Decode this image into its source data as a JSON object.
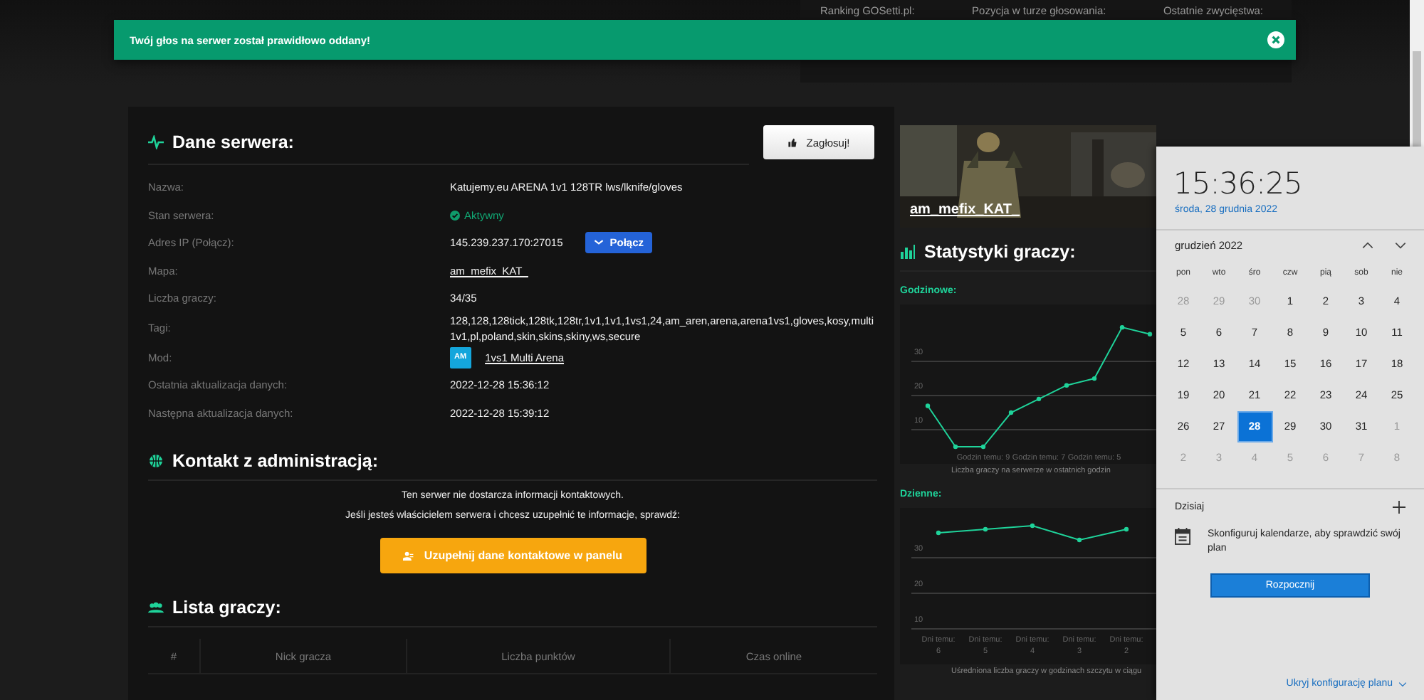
{
  "toast": {
    "message": "Twój głos na serwer został prawidłowo oddany!"
  },
  "header_stats": [
    "Ranking GOSetti.pl:",
    "Pozycja w turze głosowania:",
    "Ostatnie zwycięstwa:"
  ],
  "server": {
    "title": "Dane serwera:",
    "vote_button": "Zagłosuj!",
    "fields": [
      {
        "label": "Nazwa:",
        "kind": "text",
        "value": "Katujemy.eu ARENA 1v1 128TR lws/lknife/gloves"
      },
      {
        "label": "Stan serwera:",
        "kind": "status",
        "value": "Aktywny"
      },
      {
        "label": "Adres IP (Połącz):",
        "kind": "ip",
        "value": "145.239.237.170:27015",
        "button": "Połącz"
      },
      {
        "label": "Mapa:",
        "kind": "link",
        "value": "am_mefix_KAT_"
      },
      {
        "label": "Liczba graczy:",
        "kind": "text",
        "value": "34/35"
      },
      {
        "label": "Tagi:",
        "kind": "text",
        "value": "128,128,128tick,128tk,128tr,1v1,1v1,1vs1,24,am_aren,arena,arena1vs1,gloves,kosy,multi 1v1,pl,poland,skin,skins,skiny,ws,secure"
      },
      {
        "label": "Mod:",
        "kind": "mod",
        "badge": "AM",
        "value": "1vs1 Multi Arena"
      },
      {
        "label": "Ostatnia aktualizacja danych:",
        "kind": "text",
        "value": "2022-12-28 15:36:12"
      },
      {
        "label": "Następna aktualizacja danych:",
        "kind": "text",
        "value": "2022-12-28 15:39:12"
      }
    ]
  },
  "contact": {
    "title": "Kontakt z administracją:",
    "lines": [
      "Ten serwer nie dostarcza informacji kontaktowych.",
      "Jeśli jesteś właścicielem serwera i chcesz uzupełnić te informacje, sprawdź:"
    ],
    "button": "Uzupełnij dane kontaktowe w panelu"
  },
  "players": {
    "title": "Lista graczy:",
    "columns": [
      "#",
      "Nick gracza",
      "Liczba punktów",
      "Czas online"
    ]
  },
  "map_card": {
    "name": "am_mefix_KAT_"
  },
  "stats": {
    "title": "Statystyki graczy:",
    "hourly": {
      "label": "Godzinowe:",
      "caption": "Liczba graczy na serwerze w ostatnich godzin",
      "chart_data": {
        "type": "line",
        "x": [
          11,
          10,
          9,
          8,
          7,
          6,
          5,
          4,
          3
        ],
        "xlim": [
          12,
          2.77
        ],
        "xticks": [
          {
            "value": 9,
            "label": "Godzin temu: 9"
          },
          {
            "value": 7,
            "label": "Godzin temu: 7"
          },
          {
            "value": 5,
            "label": "Godzin temu: 5"
          }
        ],
        "ylim": [
          0,
          46.7
        ],
        "yticks": [
          10,
          20,
          30
        ],
        "grid": true,
        "series": [
          {
            "color": "#1fd39a",
            "marker": "circle",
            "values": [
              17,
              5,
              5,
              15,
              19,
              23,
              25,
              40,
              38
            ]
          }
        ]
      }
    },
    "daily": {
      "label": "Dzienne:",
      "caption": "Uśredniona liczba graczy w godzinach szczytu w ciągu",
      "chart_data": {
        "type": "line",
        "categories": [
          "Dni temu: 6",
          "Dni temu: 5",
          "Dni temu: 4",
          "Dni temu: 3",
          "Dni temu: 2"
        ],
        "ylim": [
          0,
          44
        ],
        "yticks": [
          10,
          20,
          30
        ],
        "grid": true,
        "series": [
          {
            "color": "#1fd39a",
            "marker": "circle",
            "values": [
              37,
              38,
              39,
              35,
              38
            ]
          }
        ]
      }
    }
  },
  "calendar": {
    "time": "15:36:25",
    "date": "środa, 28 grudnia 2022",
    "month": "grudzień 2022",
    "weekdays": [
      "pon",
      "wto",
      "śro",
      "czw",
      "pią",
      "sob",
      "nie"
    ],
    "days": [
      {
        "day": "28",
        "in_month": false,
        "selected": false
      },
      {
        "day": "29",
        "in_month": false,
        "selected": false
      },
      {
        "day": "30",
        "in_month": false,
        "selected": false
      },
      {
        "day": "1",
        "in_month": true,
        "selected": false
      },
      {
        "day": "2",
        "in_month": true,
        "selected": false
      },
      {
        "day": "3",
        "in_month": true,
        "selected": false
      },
      {
        "day": "4",
        "in_month": true,
        "selected": false
      },
      {
        "day": "5",
        "in_month": true,
        "selected": false
      },
      {
        "day": "6",
        "in_month": true,
        "selected": false
      },
      {
        "day": "7",
        "in_month": true,
        "selected": false
      },
      {
        "day": "8",
        "in_month": true,
        "selected": false
      },
      {
        "day": "9",
        "in_month": true,
        "selected": false
      },
      {
        "day": "10",
        "in_month": true,
        "selected": false
      },
      {
        "day": "11",
        "in_month": true,
        "selected": false
      },
      {
        "day": "12",
        "in_month": true,
        "selected": false
      },
      {
        "day": "13",
        "in_month": true,
        "selected": false
      },
      {
        "day": "14",
        "in_month": true,
        "selected": false
      },
      {
        "day": "15",
        "in_month": true,
        "selected": false
      },
      {
        "day": "16",
        "in_month": true,
        "selected": false
      },
      {
        "day": "17",
        "in_month": true,
        "selected": false
      },
      {
        "day": "18",
        "in_month": true,
        "selected": false
      },
      {
        "day": "19",
        "in_month": true,
        "selected": false
      },
      {
        "day": "20",
        "in_month": true,
        "selected": false
      },
      {
        "day": "21",
        "in_month": true,
        "selected": false
      },
      {
        "day": "22",
        "in_month": true,
        "selected": false
      },
      {
        "day": "23",
        "in_month": true,
        "selected": false
      },
      {
        "day": "24",
        "in_month": true,
        "selected": false
      },
      {
        "day": "25",
        "in_month": true,
        "selected": false
      },
      {
        "day": "26",
        "in_month": true,
        "selected": false
      },
      {
        "day": "27",
        "in_month": true,
        "selected": false
      },
      {
        "day": "28",
        "in_month": true,
        "selected": true
      },
      {
        "day": "29",
        "in_month": true,
        "selected": false
      },
      {
        "day": "30",
        "in_month": true,
        "selected": false
      },
      {
        "day": "31",
        "in_month": true,
        "selected": false
      },
      {
        "day": "1",
        "in_month": false,
        "selected": false
      },
      {
        "day": "2",
        "in_month": false,
        "selected": false
      },
      {
        "day": "3",
        "in_month": false,
        "selected": false
      },
      {
        "day": "4",
        "in_month": false,
        "selected": false
      },
      {
        "day": "5",
        "in_month": false,
        "selected": false
      },
      {
        "day": "6",
        "in_month": false,
        "selected": false
      },
      {
        "day": "7",
        "in_month": false,
        "selected": false
      },
      {
        "day": "8",
        "in_month": false,
        "selected": false
      }
    ],
    "today_label": "Dzisiaj",
    "prompt": "Skonfiguruj kalendarze, aby sprawdzić swój plan",
    "start_button": "Rozpocznij",
    "hide_link": "Ukryj konfigurację planu"
  }
}
